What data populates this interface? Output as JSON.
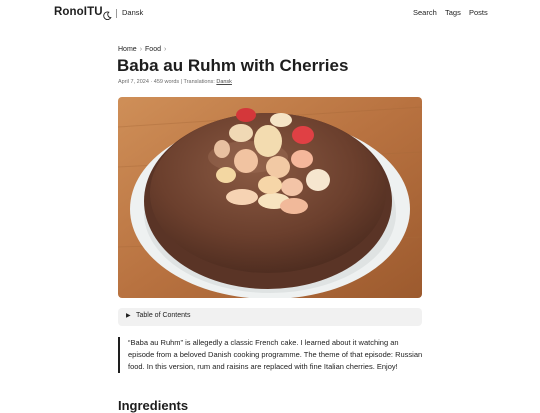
{
  "header": {
    "logo": "RonoITU",
    "theme_icon": "moon-icon",
    "language": "Dansk",
    "nav": {
      "search": "Search",
      "tags": "Tags",
      "posts": "Posts"
    }
  },
  "breadcrumb": {
    "home": "Home",
    "section": "Food",
    "separator": "›"
  },
  "post": {
    "title": "Baba au Ruhm with Cherries",
    "meta_prefix": "April 7, 2024 · 459 words | Translations:",
    "translation_link": "Dansk"
  },
  "toc": {
    "label": "Table of Contents",
    "icon": "triangle-right-icon"
  },
  "intro": "“Baba au Ruhm” is allegedly a classic French cake. I learned about it watching an episode from a beloved Danish cooking programme. The theme of that episode: Russian food. In this version, rum and raisins are replaced with fine Italian cherries. Enjoy!",
  "next_heading": "Ingredients"
}
